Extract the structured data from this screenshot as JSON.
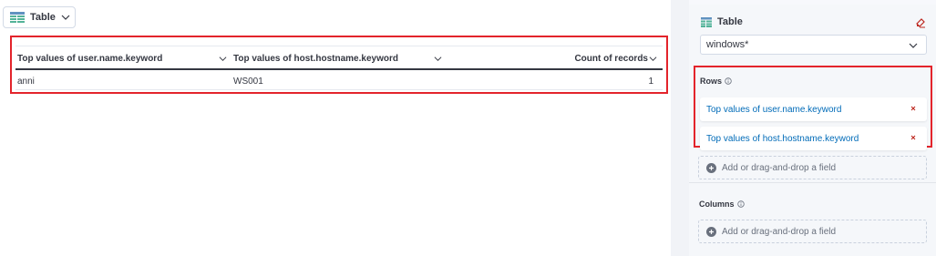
{
  "toolbar": {
    "viz_type_label": "Table"
  },
  "table": {
    "columns": [
      "Top values of user.name.keyword",
      "Top values of host.hostname.keyword",
      "Count of records"
    ],
    "rows": [
      [
        "anni",
        "WS001",
        "1"
      ]
    ]
  },
  "panel": {
    "title": "Table",
    "index_pattern": "windows*",
    "rows_section": {
      "label": "Rows",
      "fields": [
        "Top values of user.name.keyword",
        "Top values of host.hostname.keyword"
      ],
      "add_label": "Add or drag-and-drop a field"
    },
    "columns_section": {
      "label": "Columns",
      "add_label": "Add or drag-and-drop a field"
    }
  },
  "colors": {
    "accent_link": "#006bb8",
    "highlight_border": "#e3242b",
    "remove_x": "#bd271e",
    "table_icon": "#54b399"
  }
}
